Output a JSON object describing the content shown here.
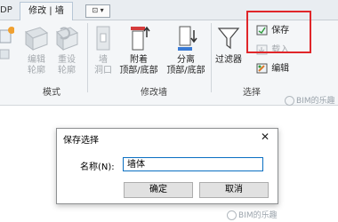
{
  "tabs": {
    "left_partial": "DP",
    "active": "修改 | 墙"
  },
  "qat": {
    "label": "⊡ ▾"
  },
  "ribbon": {
    "tools": [
      {
        "name": "edit-profile",
        "label": "编辑\n轮廓",
        "enabled": false
      },
      {
        "name": "reset-profile",
        "label": "重设\n轮廓",
        "enabled": false
      },
      {
        "name": "wall-opening",
        "label": "墙\n洞口",
        "enabled": false
      },
      {
        "name": "attach-top-base",
        "label": "附着\n顶部/底部",
        "enabled": true
      },
      {
        "name": "detach-top-base",
        "label": "分离\n顶部/底部",
        "enabled": true
      },
      {
        "name": "filter",
        "label": "过滤器",
        "enabled": true
      }
    ],
    "selection": {
      "save": "保存",
      "load": "载入",
      "edit": "编辑"
    },
    "groups": {
      "mode": "模式",
      "modify_wall": "修改墙",
      "selection": "选择"
    }
  },
  "watermarks": {
    "top": "BIM的乐趣",
    "bottom": "BIM的乐趣"
  },
  "dialog": {
    "title": "保存选择",
    "close": "✕",
    "name_label": "名称(N):",
    "name_value": "墙体",
    "ok": "确定",
    "cancel": "取消"
  },
  "colors": {
    "highlight_box": "#e0262a",
    "input_focus": "#0a6fc2"
  }
}
